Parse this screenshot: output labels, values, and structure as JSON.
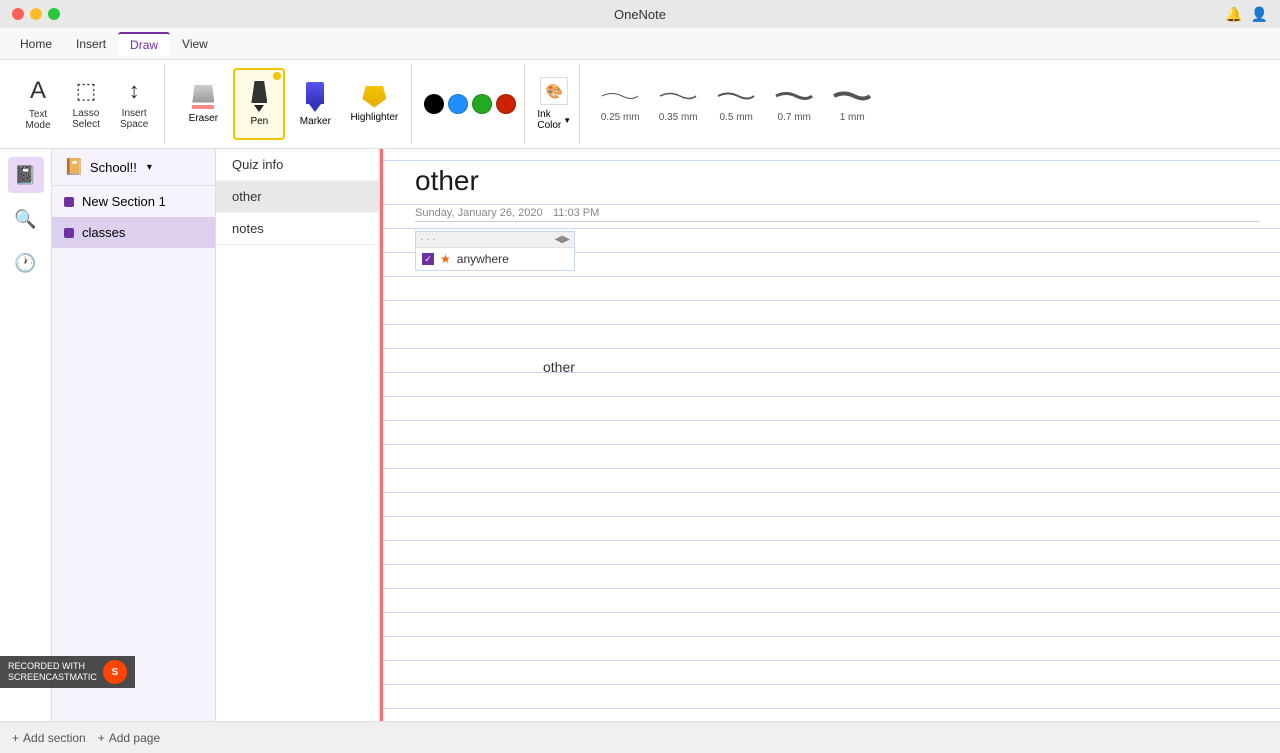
{
  "app": {
    "title": "OneNote",
    "window_controls": {
      "close": "close",
      "minimize": "minimize",
      "maximize": "maximize"
    }
  },
  "ribbon": {
    "tabs": [
      {
        "id": "home",
        "label": "Home"
      },
      {
        "id": "insert",
        "label": "Insert"
      },
      {
        "id": "draw",
        "label": "Draw"
      },
      {
        "id": "view",
        "label": "View"
      }
    ],
    "active_tab": "draw",
    "tools": {
      "text_mode": {
        "label": "Text\nMode"
      },
      "lasso_select": {
        "label": "Lasso\nSelect"
      },
      "insert_space": {
        "label": "Insert\nSpace"
      },
      "eraser": {
        "label": "Eraser"
      },
      "pen": {
        "label": "Pen"
      },
      "marker": {
        "label": "Marker"
      },
      "highlighter": {
        "label": "Highlighter"
      },
      "ink_color": {
        "label": "Ink\nColor"
      }
    },
    "colors": [
      "#000000",
      "#1e90ff",
      "#22aa22",
      "#cc2200"
    ],
    "stroke_sizes": [
      {
        "size": "0.25 mm",
        "thickness": 1
      },
      {
        "size": "0.35 mm",
        "thickness": 2
      },
      {
        "size": "0.5 mm",
        "thickness": 3
      },
      {
        "size": "0.7 mm",
        "thickness": 4
      },
      {
        "size": "1 mm",
        "thickness": 5
      }
    ]
  },
  "sidebar": {
    "notebook_name": "School!!",
    "sections": [
      {
        "id": "new-section-1",
        "label": "New Section 1",
        "active": false
      },
      {
        "id": "classes",
        "label": "classes",
        "active": true
      }
    ]
  },
  "pages": {
    "items": [
      {
        "id": "quiz-info",
        "label": "Quiz info",
        "active": false
      },
      {
        "id": "other",
        "label": "other",
        "active": true
      },
      {
        "id": "notes",
        "label": "notes",
        "active": false
      }
    ]
  },
  "page": {
    "title": "other",
    "date": "Sunday, January 26, 2020",
    "time": "11:03 PM",
    "task": {
      "text": "anywhere"
    },
    "body_text": "other"
  },
  "bottom_bar": {
    "add_section": "Add section",
    "add_page": "Add page"
  },
  "watermark": {
    "line1": "RECORDED WITH",
    "line2": "SCREENCAST",
    "suffix": "MATIC"
  }
}
